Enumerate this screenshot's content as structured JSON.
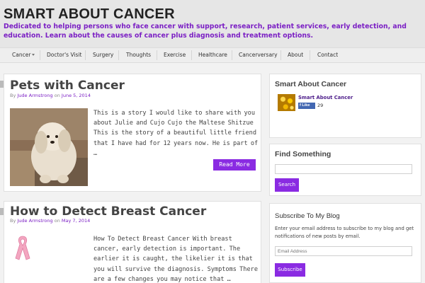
{
  "site": {
    "title": "SMART ABOUT CANCER",
    "description": "Dedicated to helping persons who face cancer with support, research, patient services, early detection, and education. Learn about the causes of cancer plus diagnosis and treatment options."
  },
  "nav": {
    "items": [
      "Cancer",
      "Doctor's Visit",
      "Surgery",
      "Thoughts",
      "Exercise",
      "Healthcare",
      "Cancerversary",
      "About",
      "Contact"
    ]
  },
  "posts": [
    {
      "title": "Pets with Cancer",
      "meta_by": "By",
      "author": "Jude Armstrong",
      "meta_on": "on",
      "date": "June 5, 2014",
      "excerpt": "This is a story I would like to share with you about Julie and Cujo Cujo  the Maltese Shitzue This is the story of a beautiful little friend that I have had for 12 years now. He is part of …",
      "read_more": "Read More",
      "image_icon": "dog-photo"
    },
    {
      "title": "How to Detect Breast Cancer",
      "meta_by": "By",
      "author": "Jude Armstrong",
      "meta_on": "on",
      "date": "May 7, 2014",
      "excerpt": "How To Detect Breast Cancer   With breast cancer, early detection is important. The earlier it is caught, the likelier it is that you will survive the diagnosis.   Symptoms There are a few changes you may notice that …",
      "image_icon": "pink-ribbon-icon"
    }
  ],
  "sidebar": {
    "fb_widget": {
      "title": "Smart About Cancer",
      "page_name": "Smart About Cancer",
      "like_label": "Like",
      "like_count": "29"
    },
    "search_widget": {
      "title": "Find Something",
      "input_value": "",
      "button_label": "Search"
    },
    "subscribe_widget": {
      "title": "Subscribe To My Blog",
      "text": "Enter your email address to subscribe to my blog and get notifications of new posts by email.",
      "input_placeholder": "Email Address",
      "button_label": "Subscribe"
    }
  },
  "colors": {
    "accent": "#8a2be2",
    "header_bg": "#e6e6e6",
    "tagline": "#7b1fc4"
  }
}
